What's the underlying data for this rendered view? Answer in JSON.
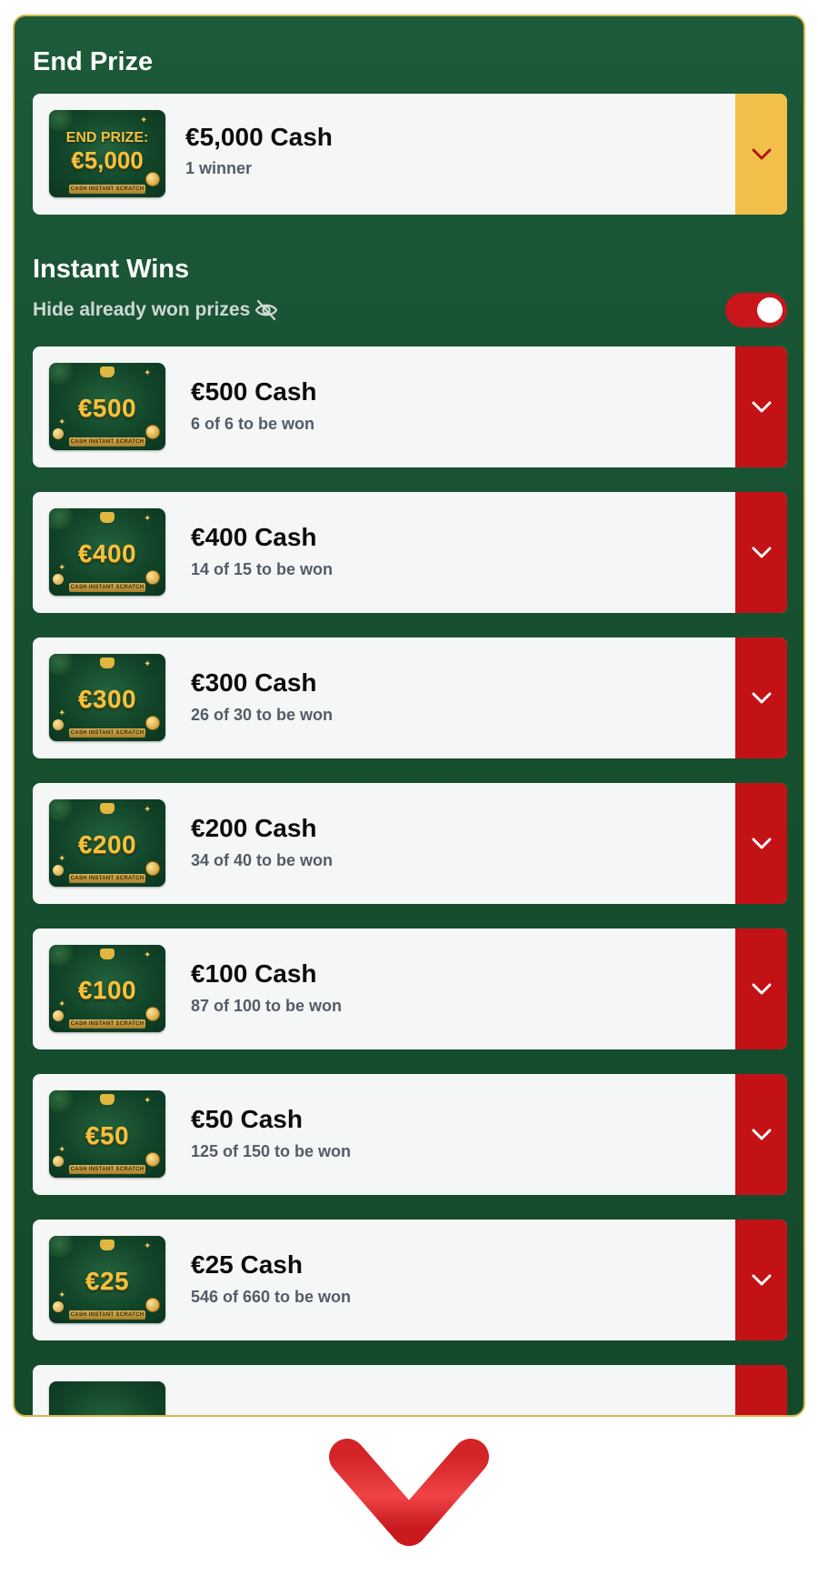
{
  "end_prize": {
    "section_title": "End Prize",
    "thumb_line1": "END PRIZE:",
    "thumb_line2": "€5,000",
    "title": "€5,000 Cash",
    "subtitle": "1 winner",
    "toggle_color": "#f2c04a"
  },
  "instant_wins": {
    "section_title": "Instant Wins",
    "hide_label": "Hide already won prizes",
    "hide_toggle_on": true,
    "thumb_ribbon": "CASH INSTANT SCRATCH",
    "toggle_color": "#c31216",
    "items": [
      {
        "thumb": "€500",
        "title": "€500 Cash",
        "subtitle": "6 of 6 to be won"
      },
      {
        "thumb": "€400",
        "title": "€400 Cash",
        "subtitle": "14 of 15 to be won"
      },
      {
        "thumb": "€300",
        "title": "€300 Cash",
        "subtitle": "26 of 30 to be won"
      },
      {
        "thumb": "€200",
        "title": "€200 Cash",
        "subtitle": "34 of 40 to be won"
      },
      {
        "thumb": "€100",
        "title": "€100 Cash",
        "subtitle": "87 of 100 to be won"
      },
      {
        "thumb": "€50",
        "title": "€50 Cash",
        "subtitle": "125 of 150 to be won"
      },
      {
        "thumb": "€25",
        "title": "€25 Cash",
        "subtitle": "546 of 660 to be won"
      }
    ]
  },
  "icons": {
    "chevron": "chevron-down-icon",
    "eye": "eye-off-icon",
    "arrow": "arrow-down-icon"
  },
  "colors": {
    "panel_bg": "#16502f",
    "panel_border": "#d7b64c",
    "accent_red": "#c31216",
    "accent_yellow": "#f2c04a",
    "card_bg": "#f5f7f7"
  }
}
